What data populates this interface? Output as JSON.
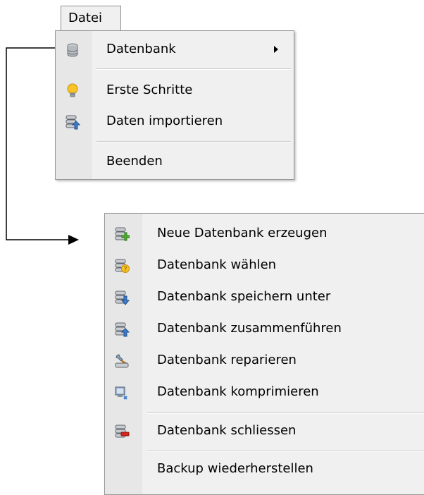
{
  "menubar": {
    "datei_label": "Datei"
  },
  "datei_menu": {
    "items": [
      {
        "label": "Datenbank",
        "icon": "database-icon",
        "has_submenu": true
      },
      {
        "label": "Erste Schritte",
        "icon": "lightbulb-icon"
      },
      {
        "label": "Daten importieren",
        "icon": "database-import-icon"
      },
      {
        "label": "Beenden",
        "icon": ""
      }
    ]
  },
  "database_submenu": {
    "items": [
      {
        "label": "Neue Datenbank erzeugen",
        "icon": "database-add-icon"
      },
      {
        "label": "Datenbank wählen",
        "icon": "database-select-icon"
      },
      {
        "label": "Datenbank speichern unter",
        "icon": "database-save-icon"
      },
      {
        "label": "Datenbank zusammenführen",
        "icon": "database-merge-icon"
      },
      {
        "label": "Datenbank reparieren",
        "icon": "database-repair-icon"
      },
      {
        "label": "Datenbank komprimieren",
        "icon": "database-compress-icon"
      },
      {
        "label": "Datenbank schliessen",
        "icon": "database-close-icon"
      },
      {
        "label": "Backup wiederherstellen",
        "icon": ""
      }
    ]
  },
  "colors": {
    "menu_bg": "#f0f0f0",
    "gutter_bg": "#e7e7e7",
    "db_gray": "#9aa0a6",
    "db_blue": "#3d7cc9",
    "add_green": "#4caf2e",
    "close_red": "#d9251d",
    "bulb_yellow": "#f7c325"
  }
}
